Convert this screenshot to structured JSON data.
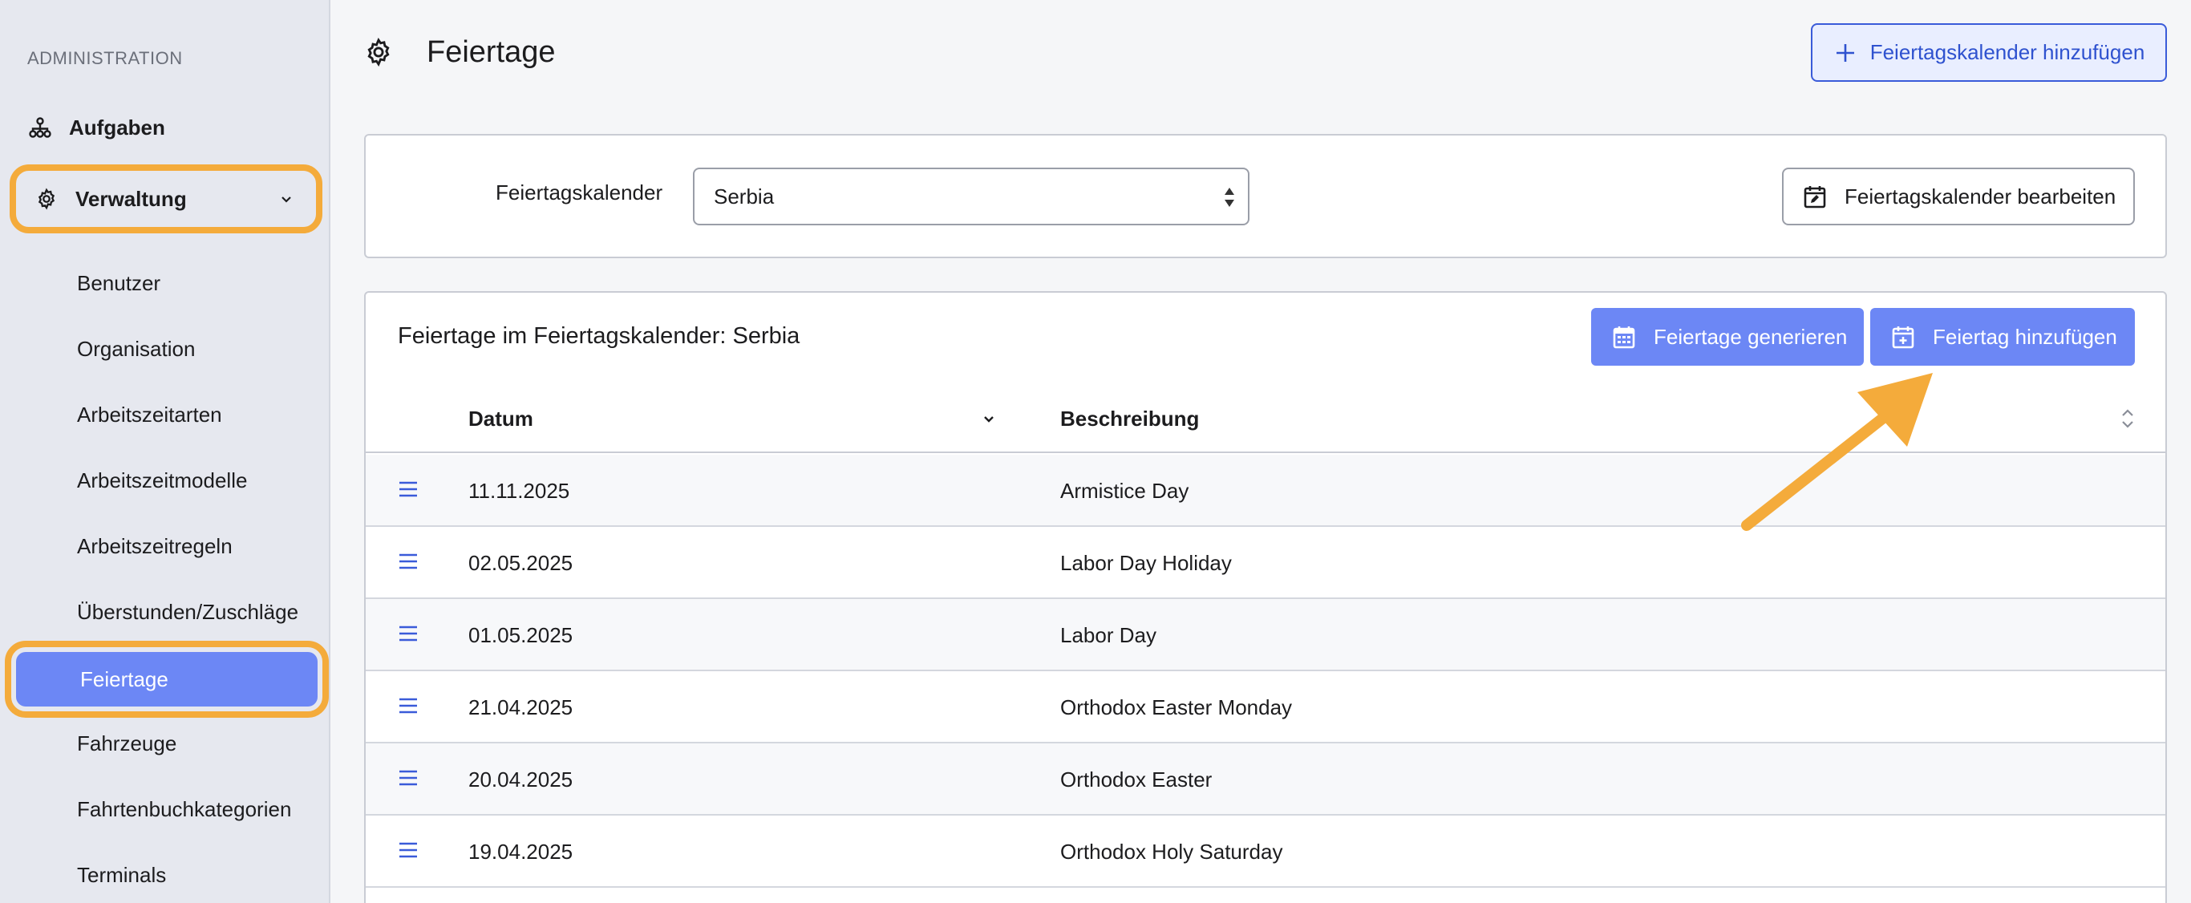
{
  "sidebar": {
    "section_label": "ADMINISTRATION",
    "aufgaben_label": "Aufgaben",
    "verwaltung_label": "Verwaltung",
    "items": [
      {
        "label": "Benutzer"
      },
      {
        "label": "Organisation"
      },
      {
        "label": "Arbeitszeitarten"
      },
      {
        "label": "Arbeitszeitmodelle"
      },
      {
        "label": "Arbeitszeitregeln"
      },
      {
        "label": "Überstunden/Zuschläge"
      },
      {
        "label": "Feiertage"
      },
      {
        "label": "Fahrzeuge"
      },
      {
        "label": "Fahrtenbuchkategorien"
      },
      {
        "label": "Terminals"
      }
    ],
    "active_item": "Feiertage"
  },
  "header": {
    "title": "Feiertage",
    "add_calendar_label": "Feiertagskalender hinzufügen"
  },
  "calendar_select": {
    "label": "Feiertagskalender",
    "value": "Serbia",
    "edit_label": "Feiertagskalender bearbeiten"
  },
  "holidays": {
    "title": "Feiertage im Feiertagskalender: Serbia",
    "generate_label": "Feiertage generieren",
    "add_label": "Feiertag hinzufügen",
    "columns": {
      "date": "Datum",
      "description": "Beschreibung"
    },
    "rows": [
      {
        "date": "11.11.2025",
        "description": "Armistice Day"
      },
      {
        "date": "02.05.2025",
        "description": "Labor Day Holiday"
      },
      {
        "date": "01.05.2025",
        "description": "Labor Day"
      },
      {
        "date": "21.04.2025",
        "description": "Orthodox Easter Monday"
      },
      {
        "date": "20.04.2025",
        "description": "Orthodox Easter"
      },
      {
        "date": "19.04.2025",
        "description": "Orthodox Holy Saturday"
      }
    ]
  },
  "colors": {
    "accent": "#6c87f5",
    "highlight": "#f4ab3b",
    "link_blue": "#2f52cf"
  },
  "icons": [
    "hierarchy-icon",
    "gear-icon",
    "chevron-down-icon",
    "plus-icon",
    "calendar-edit-icon",
    "calendar-grid-icon",
    "calendar-plus-icon",
    "drag-handle-icon",
    "sort-icon"
  ]
}
